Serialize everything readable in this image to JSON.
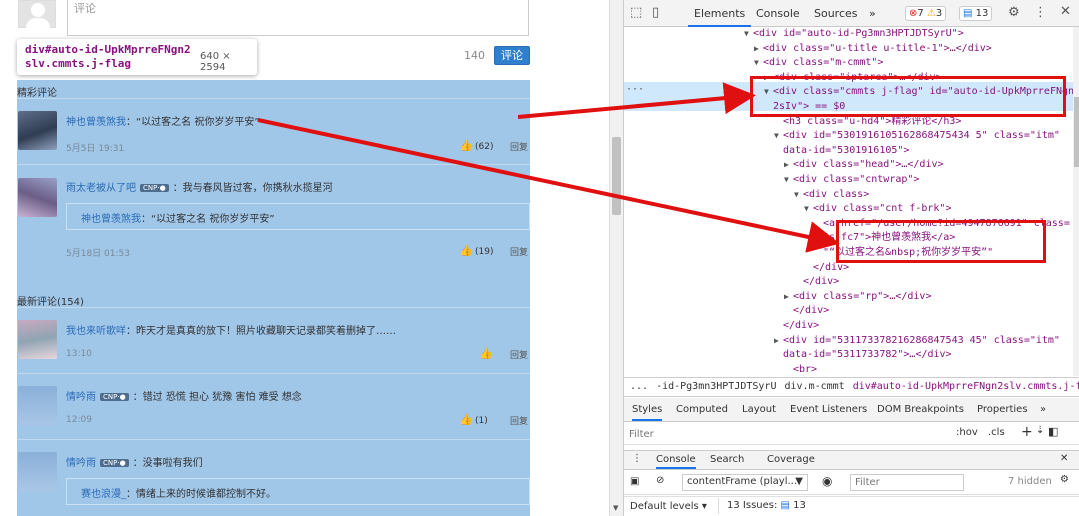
{
  "left": {
    "textarea_text": "评论",
    "counter": "140",
    "submit_label": "评论",
    "tooltip": {
      "selector": "div#auto-id-UpkMprreFNgn2slv.cmmts.j-flag",
      "size": "640 × 2594"
    },
    "section_hot": "精彩评论",
    "section_new": "最新评论(154)",
    "reply_label": "回复",
    "comments": [
      {
        "user": "神也曾羡煞我",
        "vip": "",
        "text": "：“以过客之名 祝你岁岁平安”",
        "quote_user": "",
        "quote_text": "",
        "time": "5月5日 19:31",
        "likes": "(62)"
      },
      {
        "user": "雨太老被从了吧",
        "vip": "CNP·●",
        "text": "：我与春风皆过客，你携秋水揽星河",
        "quote_user": "神也曾羡煞我",
        "quote_text": "：“以过客之名 祝你岁岁平安”",
        "time": "5月18日 01:53",
        "likes": "(19)"
      },
      {
        "user": "我也来听歌咩",
        "vip": "",
        "text": "：昨天才是真真的放下！照片收藏聊天记录都笑着删掉了……",
        "quote_user": "",
        "quote_text": "",
        "time": "13:10",
        "likes": ""
      },
      {
        "user": "情吟雨",
        "vip": "CNP·●",
        "text": "：错过 恐慌 担心 犹豫 害怕 难受 想念",
        "quote_user": "",
        "quote_text": "",
        "time": "12:09",
        "likes": "(1)"
      },
      {
        "user": "情吟雨",
        "vip": "CNP·●",
        "text": "：没事啦有我们",
        "quote_user": "赛也浪漫_",
        "quote_text": "：情绪上来的时候谁都控制不好。",
        "time": "",
        "likes": ""
      }
    ]
  },
  "devtools": {
    "tabs": [
      "Elements",
      "Console",
      "Sources"
    ],
    "errors": "7",
    "warnings": "3",
    "messages": "13",
    "dom_lines": [
      {
        "indent": 0,
        "tri": "▼",
        "html": "<div id=\"auto-id-Pg3mn3HPTJDTSyrU\">"
      },
      {
        "indent": 1,
        "tri": "▶",
        "html": "<div class=\"u-title u-title-1\">…</div>"
      },
      {
        "indent": 1,
        "tri": "▼",
        "html": "<div class=\"m-cmmt\">"
      },
      {
        "indent": 2,
        "tri": "▶",
        "html": "<div class=\"iptarea\">…</div>"
      },
      {
        "indent": 2,
        "tri": "▼",
        "html": "<div class=\"cmmts j-flag\" id=\"auto-id-UpkMprreFNgn"
      },
      {
        "indent": 2,
        "tri": "",
        "html": "2sIv\"> == $0"
      },
      {
        "indent": 3,
        "tri": "",
        "html": "<h3 class=\"u-hd4\">精彩评论</h3>"
      },
      {
        "indent": 3,
        "tri": "▼",
        "html": "<div id=\"5301916105162868475434 5\" class=\"itm\""
      },
      {
        "indent": 3,
        "tri": "",
        "html": "data-id=\"5301916105\">"
      },
      {
        "indent": 4,
        "tri": "▶",
        "html": "<div class=\"head\">…</div>"
      },
      {
        "indent": 4,
        "tri": "▼",
        "html": "<div class=\"cntwrap\">"
      },
      {
        "indent": 5,
        "tri": "▼",
        "html": "<div class>"
      },
      {
        "indent": 6,
        "tri": "▼",
        "html": "<div class=\"cnt f-brk\">"
      },
      {
        "indent": 7,
        "tri": "",
        "html": "<a href=\"/user/home?id=4947876691\" class="
      },
      {
        "indent": 7,
        "tri": "",
        "html": "\"s-fc7\">神也曾羡煞我</a>"
      },
      {
        "indent": 7,
        "tri": "",
        "html": "\"“以过客之名&nbsp;祝你岁岁平安”\""
      },
      {
        "indent": 6,
        "tri": "",
        "html": "</div>"
      },
      {
        "indent": 5,
        "tri": "",
        "html": "</div>"
      },
      {
        "indent": 4,
        "tri": "▶",
        "html": "<div class=\"rp\">…</div>"
      },
      {
        "indent": 4,
        "tri": "",
        "html": "</div>"
      },
      {
        "indent": 3,
        "tri": "",
        "html": "</div>"
      },
      {
        "indent": 3,
        "tri": "▶",
        "html": "<div id=\"531173378216286847543 45\" class=\"itm\""
      },
      {
        "indent": 3,
        "tri": "",
        "html": "data-id=\"5311733782\">…</div>"
      },
      {
        "indent": 4,
        "tri": "",
        "html": "<br>"
      },
      {
        "indent": 4,
        "tri": "",
        "html": "<br>"
      }
    ],
    "breadcrumbs": [
      "...",
      "-id-Pg3mn3HPTJDTSyrU",
      "div.m-cmmt",
      "div#auto-id-UpkMprreFNgn2slv.cmmts.j-flag"
    ],
    "style_tabs": [
      "Styles",
      "Computed",
      "Layout",
      "Event Listeners",
      "DOM Breakpoints",
      "Properties"
    ],
    "filter_placeholder": "Filter",
    "hov": ":hov",
    "cls": ".cls",
    "drawer_tabs": [
      "Console",
      "Search",
      "Coverage"
    ],
    "context": "contentFrame (playl...",
    "console_filter_placeholder": "Filter",
    "hidden": "7 hidden",
    "levels": "Default levels",
    "issues": "13 Issues:",
    "issues_count": "13"
  }
}
